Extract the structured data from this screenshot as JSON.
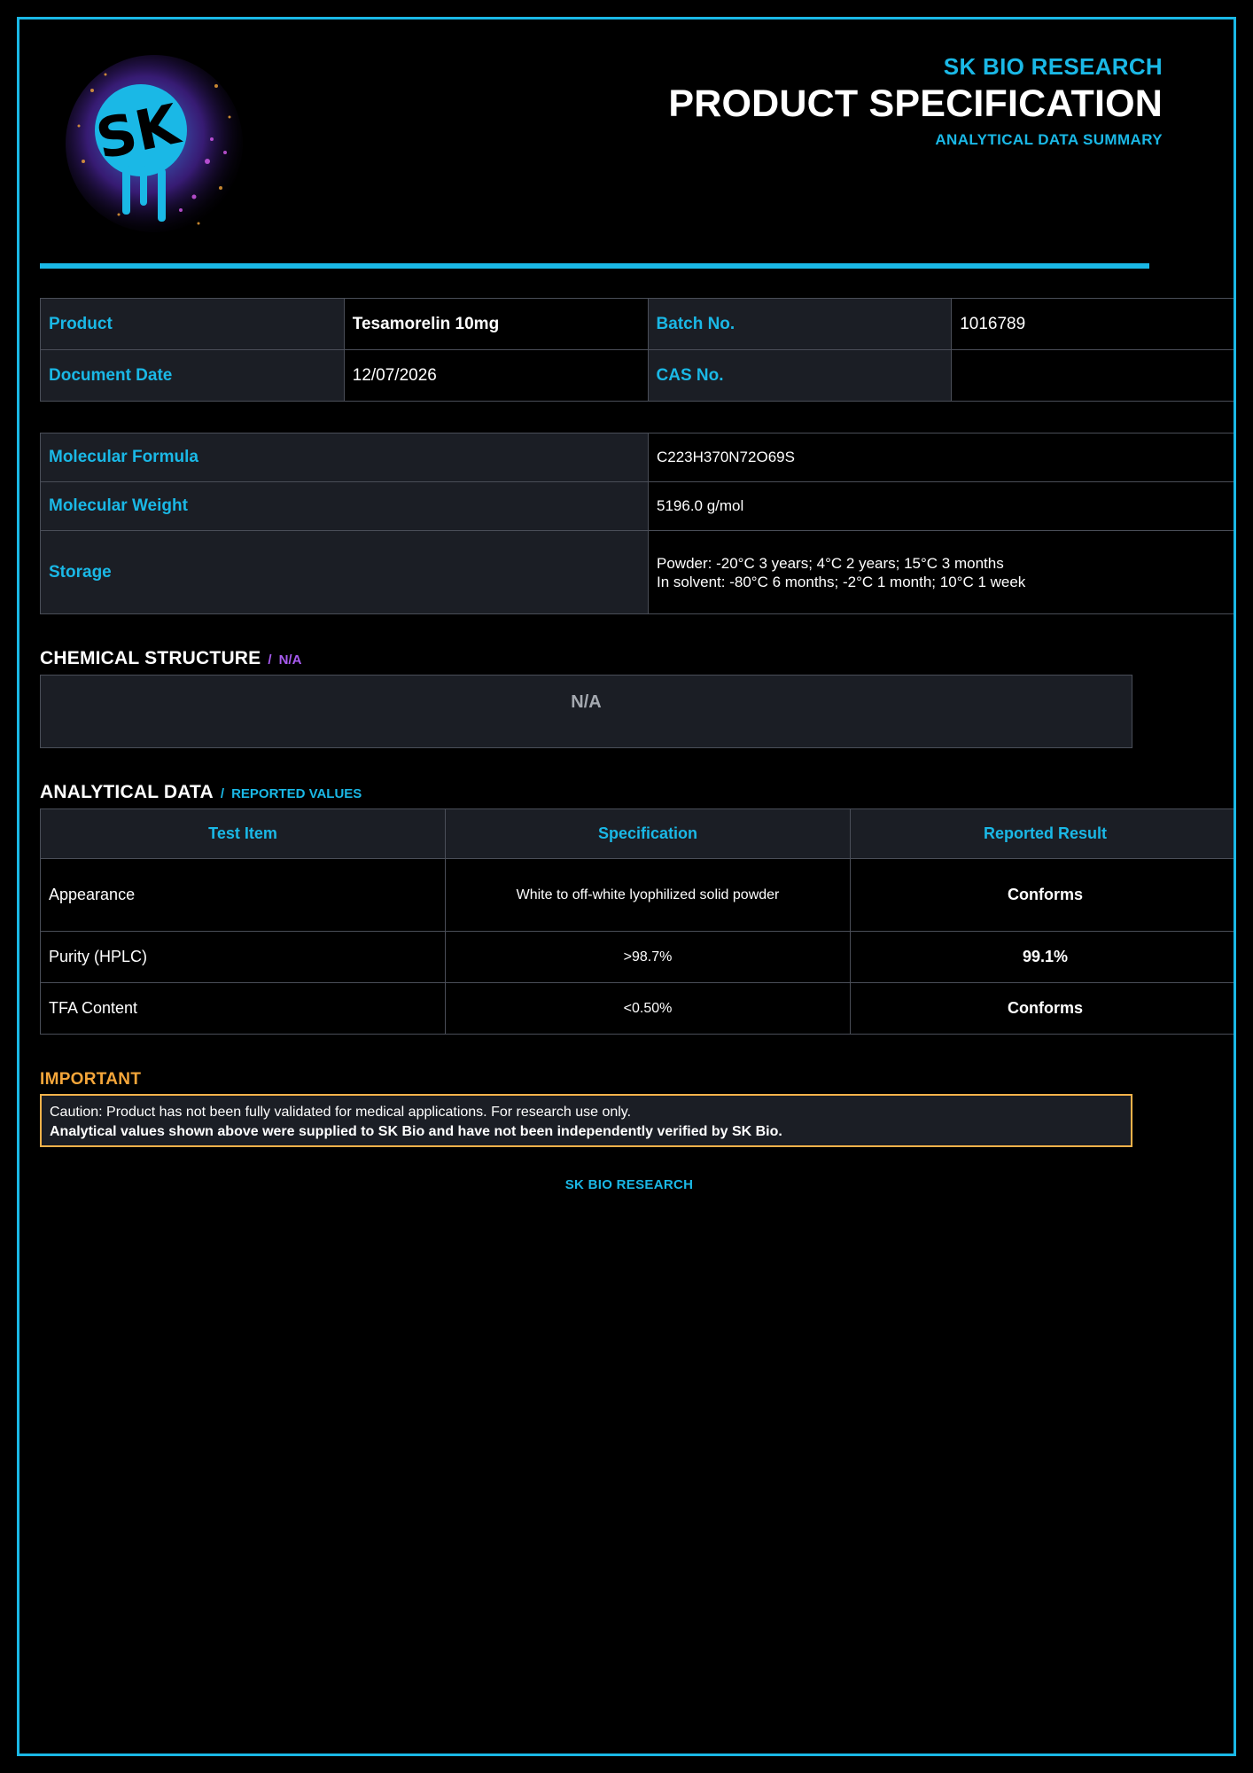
{
  "header": {
    "company": "SK BIO RESEARCH",
    "title": "PRODUCT SPECIFICATION",
    "subtitle": "ANALYTICAL DATA SUMMARY",
    "logo_text": "SK"
  },
  "info": {
    "product_label": "Product",
    "product_value": "Tesamorelin 10mg",
    "batch_label": "Batch No.",
    "batch_value": "1016789",
    "date_label": "Document Date",
    "date_value": "12/07/2026",
    "cas_label": "CAS No.",
    "cas_value": ""
  },
  "properties": {
    "formula_label": "Molecular Formula",
    "formula_value": "C223H370N72O69S",
    "weight_label": "Molecular Weight",
    "weight_value": "5196.0 g/mol",
    "storage_label": "Storage",
    "storage_line1": "Powder: -20°C 3 years; 4°C 2 years; 15°C 3 months",
    "storage_line2": "In solvent: -80°C 6 months; -2°C 1 month; 10°C 1 week"
  },
  "chemical_structure": {
    "title": "CHEMICAL STRUCTURE",
    "separator": "/",
    "tag": "N/A",
    "placeholder": "N/A"
  },
  "analytical": {
    "title": "ANALYTICAL DATA",
    "separator": "/",
    "tag": "REPORTED VALUES",
    "columns": [
      "Test Item",
      "Specification",
      "Reported Result"
    ],
    "rows": [
      {
        "item": "Appearance",
        "spec": "White to off-white lyophilized solid powder",
        "result": "Conforms"
      },
      {
        "item": "Purity (HPLC)",
        "spec": ">98.7%",
        "result": "99.1%"
      },
      {
        "item": "TFA Content",
        "spec": "<0.50%",
        "result": "Conforms"
      }
    ]
  },
  "important": {
    "title": "IMPORTANT",
    "line1": "Caution: Product has not been fully validated for medical applications. For research use only.",
    "line2": "Analytical values shown above were supplied to SK Bio and have not been independently verified by SK Bio."
  },
  "footer": {
    "text": "SK BIO RESEARCH"
  },
  "colors": {
    "accent": "#1ab8e6",
    "purple": "#a85bf0",
    "warning": "#f5a63a",
    "background": "#000000",
    "panel": "#1b1e25"
  }
}
